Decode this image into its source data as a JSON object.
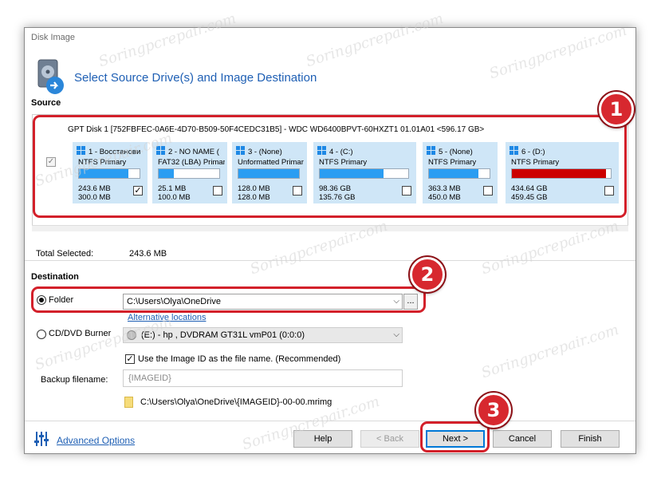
{
  "window": {
    "title": "Disk Image"
  },
  "header": {
    "title": "Select Source Drive(s) and Image Destination"
  },
  "source": {
    "label": "Source",
    "disk_title": "GPT Disk 1 [752FBFEC-0A6E-4D70-B509-50F4CEDC31B5] - WDC WD6400BPVT-60HXZT1 01.01A01  <596.17 GB>",
    "partitions": [
      {
        "header": "1 - Восстанови",
        "type": "NTFS Primary",
        "used": "243.6 MB",
        "total": "300.0 MB",
        "fill": 0.81,
        "checked": true,
        "fill_color": "#2a9df2"
      },
      {
        "header": "2 - NO NAME (",
        "type": "FAT32 (LBA) Primar",
        "used": "25.1 MB",
        "total": "100.0 MB",
        "fill": 0.25,
        "checked": false,
        "fill_color": "#2a9df2"
      },
      {
        "header": "3 - (None)",
        "type": "Unformatted Primar",
        "used": "128.0 MB",
        "total": "128.0 MB",
        "fill": 1.0,
        "checked": false,
        "fill_color": "#2a9df2"
      },
      {
        "header": "4 - (C:)",
        "type": "NTFS Primary",
        "used": "98.36 GB",
        "total": "135.76 GB",
        "fill": 0.72,
        "checked": false,
        "fill_color": "#2a9df2"
      },
      {
        "header": "5 - (None)",
        "type": "NTFS Primary",
        "used": "363.3 MB",
        "total": "450.0 MB",
        "fill": 0.81,
        "checked": false,
        "fill_color": "#2a9df2"
      },
      {
        "header": "6 - (D:)",
        "type": "NTFS Primary",
        "used": "434.64 GB",
        "total": "459.45 GB",
        "fill": 0.95,
        "checked": false,
        "fill_color": "#cc0000"
      }
    ],
    "total_selected_label": "Total Selected:",
    "total_selected_value": "243.6 MB"
  },
  "destination": {
    "label": "Destination",
    "folder_label": "Folder",
    "folder_path": "C:\\Users\\Olya\\OneDrive",
    "browse_label": "...",
    "alt_locations": "Alternative locations",
    "cd_label": "CD/DVD Burner",
    "cd_drive": "(E:) - hp      , DVDRAM GT31L     vmP01 (0:0:0)",
    "use_image_id": "Use the Image ID as the file name.  (Recommended)",
    "backup_filename_label": "Backup filename:",
    "backup_filename_placeholder": "{IMAGEID}",
    "output_path": "C:\\Users\\Olya\\OneDrive\\{IMAGEID}-00-00.mrimg"
  },
  "footer": {
    "advanced_options": "Advanced Options",
    "help": "Help",
    "back": "< Back",
    "next": "Next >",
    "cancel": "Cancel",
    "finish": "Finish"
  },
  "annotations": [
    "1",
    "2",
    "3"
  ],
  "colors": {
    "accent": "#1e5fb4",
    "badge": "#d7282f",
    "partition_bg": "#cfe6f7",
    "bar_fill": "#2a9df2"
  }
}
